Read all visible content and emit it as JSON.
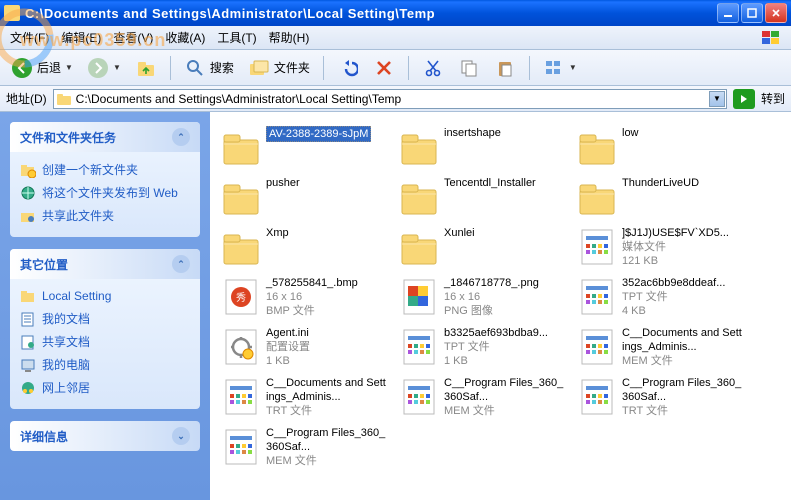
{
  "window": {
    "title": "C:\\Documents and Settings\\Administrator\\Local Setting\\Temp"
  },
  "menu": {
    "file": "文件(F)",
    "edit": "编辑(E)",
    "view": "查看(V)",
    "fav": "收藏(A)",
    "tools": "工具(T)",
    "help": "帮助(H)"
  },
  "toolbar": {
    "back": "后退",
    "search": "搜索",
    "folders": "文件夹"
  },
  "addr": {
    "label": "地址(D)",
    "path": "C:\\Documents and Settings\\Administrator\\Local Setting\\Temp",
    "go": "转到"
  },
  "sidebar": {
    "tasks": {
      "title": "文件和文件夹任务",
      "items": [
        {
          "label": "创建一个新文件夹",
          "icon": "new-folder"
        },
        {
          "label": "将这个文件夹发布到 Web",
          "icon": "publish-web"
        },
        {
          "label": "共享此文件夹",
          "icon": "share-folder"
        }
      ]
    },
    "other": {
      "title": "其它位置",
      "items": [
        {
          "label": "Local Setting",
          "icon": "folder"
        },
        {
          "label": "我的文档",
          "icon": "my-docs"
        },
        {
          "label": "共享文档",
          "icon": "shared-docs"
        },
        {
          "label": "我的电脑",
          "icon": "my-computer"
        },
        {
          "label": "网上邻居",
          "icon": "network"
        }
      ]
    },
    "details": {
      "title": "详细信息"
    }
  },
  "files": [
    {
      "name": "AV-2388-2389-sJpM",
      "type": "folder",
      "selected": true
    },
    {
      "name": "insertshape",
      "type": "folder"
    },
    {
      "name": "low",
      "type": "folder"
    },
    {
      "name": "pusher",
      "type": "folder"
    },
    {
      "name": "Tencentdl_Installer",
      "type": "folder"
    },
    {
      "name": "ThunderLiveUD",
      "type": "folder"
    },
    {
      "name": "Xmp",
      "type": "folder"
    },
    {
      "name": "Xunlei",
      "type": "folder"
    },
    {
      "name": "]$J1J)USE$FV`XD5...",
      "meta1": "媒体文件",
      "meta2": "121 KB",
      "type": "media"
    },
    {
      "name": "_578255841_.bmp",
      "meta1": "16 x 16",
      "meta2": "BMP 文件",
      "type": "bmp"
    },
    {
      "name": "_1846718778_.png",
      "meta1": "16 x 16",
      "meta2": "PNG 图像",
      "type": "png"
    },
    {
      "name": "352ac6bb9e8ddeaf...",
      "meta1": "TPT 文件",
      "meta2": "4 KB",
      "type": "generic"
    },
    {
      "name": "Agent.ini",
      "meta1": "配置设置",
      "meta2": "1 KB",
      "type": "ini"
    },
    {
      "name": "b3325aef693bdba9...",
      "meta1": "TPT 文件",
      "meta2": "1 KB",
      "type": "generic"
    },
    {
      "name": "C__Documents and Settings_Adminis...",
      "meta1": "MEM 文件",
      "type": "mem"
    },
    {
      "name": "C__Documents and Settings_Adminis...",
      "meta1": "TRT 文件",
      "type": "trt"
    },
    {
      "name": "C__Program Files_360_360Saf...",
      "meta1": "MEM 文件",
      "type": "mem"
    },
    {
      "name": "C__Program Files_360_360Saf...",
      "meta1": "TRT 文件",
      "type": "trt"
    },
    {
      "name": "C__Program Files_360_360Saf...",
      "meta1": "MEM 文件",
      "type": "mem"
    }
  ],
  "watermark": "www.pc0359.cn"
}
